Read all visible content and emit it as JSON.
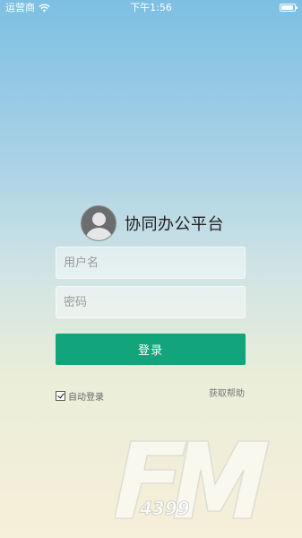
{
  "status_bar": {
    "carrier": "运营商",
    "time": "下午1:56",
    "battery_level": 0.9
  },
  "header": {
    "title": "协同办公平台"
  },
  "form": {
    "username_placeholder": "用户名",
    "password_placeholder": "密码",
    "login_label": "登录",
    "auto_login_label": "自动登录",
    "auto_login_checked": true,
    "help_label": "获取帮助"
  },
  "watermark": {
    "text_main": "FM",
    "text_small": "4399"
  },
  "colors": {
    "accent": "#12a47a"
  }
}
